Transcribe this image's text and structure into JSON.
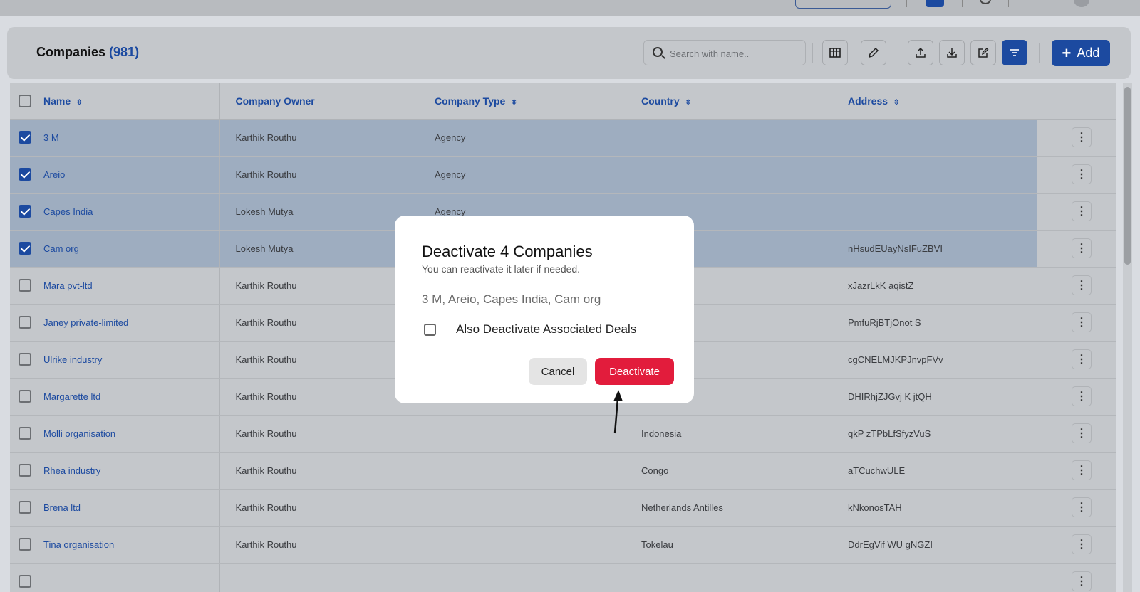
{
  "topbar": {},
  "header": {
    "title": "Companies",
    "count": "(981)",
    "search_placeholder": "Search with name..",
    "add_label": "Add"
  },
  "table": {
    "columns": [
      "Name",
      "Company Owner",
      "Company Type",
      "Country",
      "Address"
    ],
    "rows": [
      {
        "selected": true,
        "name": "3 M",
        "owner": "Karthik Routhu",
        "type": "Agency",
        "country": "",
        "address": ""
      },
      {
        "selected": true,
        "name": "Areio",
        "owner": "Karthik Routhu",
        "type": "Agency",
        "country": "",
        "address": ""
      },
      {
        "selected": true,
        "name": "Capes India",
        "owner": "Lokesh Mutya",
        "type": "Agency",
        "country": "",
        "address": ""
      },
      {
        "selected": true,
        "name": "Cam org",
        "owner": "Lokesh Mutya",
        "type": "",
        "country": "",
        "address": "nHsudEUayNsIFuZBVI"
      },
      {
        "selected": false,
        "name": "Mara pvt-ltd",
        "owner": "Karthik Routhu",
        "type": "",
        "country": "",
        "address": "xJazrLkK aqistZ"
      },
      {
        "selected": false,
        "name": "Janey private-limited",
        "owner": "Karthik Routhu",
        "type": "",
        "country": "ng",
        "address": "PmfuRjBTjOnot S"
      },
      {
        "selected": false,
        "name": "Ulrike industry",
        "owner": "Karthik Routhu",
        "type": "",
        "country": "nd Barbuda",
        "address": "cgCNELMJKPJnvpFVv"
      },
      {
        "selected": false,
        "name": "Margarette ltd",
        "owner": "Karthik Routhu",
        "type": "",
        "country": "Lithuania",
        "address": "DHIRhjZJGvj K jtQH"
      },
      {
        "selected": false,
        "name": "Molli organisation",
        "owner": "Karthik Routhu",
        "type": "",
        "country": "Indonesia",
        "address": "qkP zTPbLfSfyzVuS"
      },
      {
        "selected": false,
        "name": "Rhea industry",
        "owner": "Karthik Routhu",
        "type": "",
        "country": "Congo",
        "address": "aTCuchwULE"
      },
      {
        "selected": false,
        "name": "Brena ltd",
        "owner": "Karthik Routhu",
        "type": "",
        "country": "Netherlands Antilles",
        "address": "kNkonosTAH"
      },
      {
        "selected": false,
        "name": "Tina organisation",
        "owner": "Karthik Routhu",
        "type": "",
        "country": "Tokelau",
        "address": "DdrEgVif WU gNGZI"
      },
      {
        "selected": false,
        "name": "",
        "owner": "",
        "type": "",
        "country": "",
        "address": ""
      }
    ]
  },
  "modal": {
    "title": "Deactivate 4 Companies",
    "subtitle": "You can reactivate it later if needed.",
    "names": "3 M, Areio, Capes India, Cam org",
    "checkbox_label": "Also Deactivate Associated Deals",
    "cancel_label": "Cancel",
    "deactivate_label": "Deactivate"
  },
  "colors": {
    "primary": "#1c4aa0",
    "danger": "#e21c3c",
    "selected_row": "#9eadc0"
  }
}
